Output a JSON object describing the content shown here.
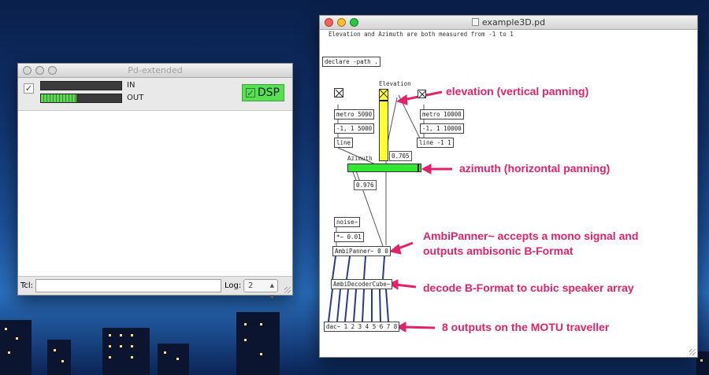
{
  "pd_extended": {
    "title": "Pd-extended",
    "meter_in_label": "IN",
    "meter_out_label": "OUT",
    "meter_in_level": 0.0,
    "meter_out_level": 0.44,
    "dsp_label": "DSP",
    "tcl_label": "Tcl:",
    "log_label": "Log:",
    "log_value": "2",
    "check_glyph": "✓"
  },
  "patch": {
    "title": "example3D.pd",
    "comment": "Elevation and Azimuth are both measured from -1 to 1",
    "declare": "declare -path .",
    "elevation_label": "Elevation",
    "azimuth_label": "Azimuth",
    "elevation_level": 0.86,
    "azimuth_level": 0.976,
    "left_chain": {
      "metro": "metro 5000",
      "msg": "-1, 1 5000",
      "line": "line"
    },
    "right_chain": {
      "metro": "metro 10000",
      "msg": "-1, 1 10000",
      "line": "line -1 1"
    },
    "elevation_value": "0.705",
    "azimuth_value": "0.976",
    "noise": "noise~",
    "gain": "*~ 0.01",
    "panner": "AmbiPanner~ 0 0",
    "decoder": "AmbiDecoderCube~",
    "dac": "dac~ 1 2 3 4 5 6 7 8"
  },
  "annotations": {
    "elevation": "elevation (vertical panning)",
    "azimuth": "azimuth (horizontal panning)",
    "panner_line1": "AmbiPanner~ accepts a mono signal and",
    "panner_line2": "outputs ambisonic B-Format",
    "decoder": "decode B-Format to cubic speaker array",
    "dac": "8 outputs on the MOTU traveller"
  },
  "colors": {
    "annotation": "#e0236a",
    "vslider": "#ffff33",
    "hslider": "#33e633",
    "dsp_on": "#56e052"
  }
}
